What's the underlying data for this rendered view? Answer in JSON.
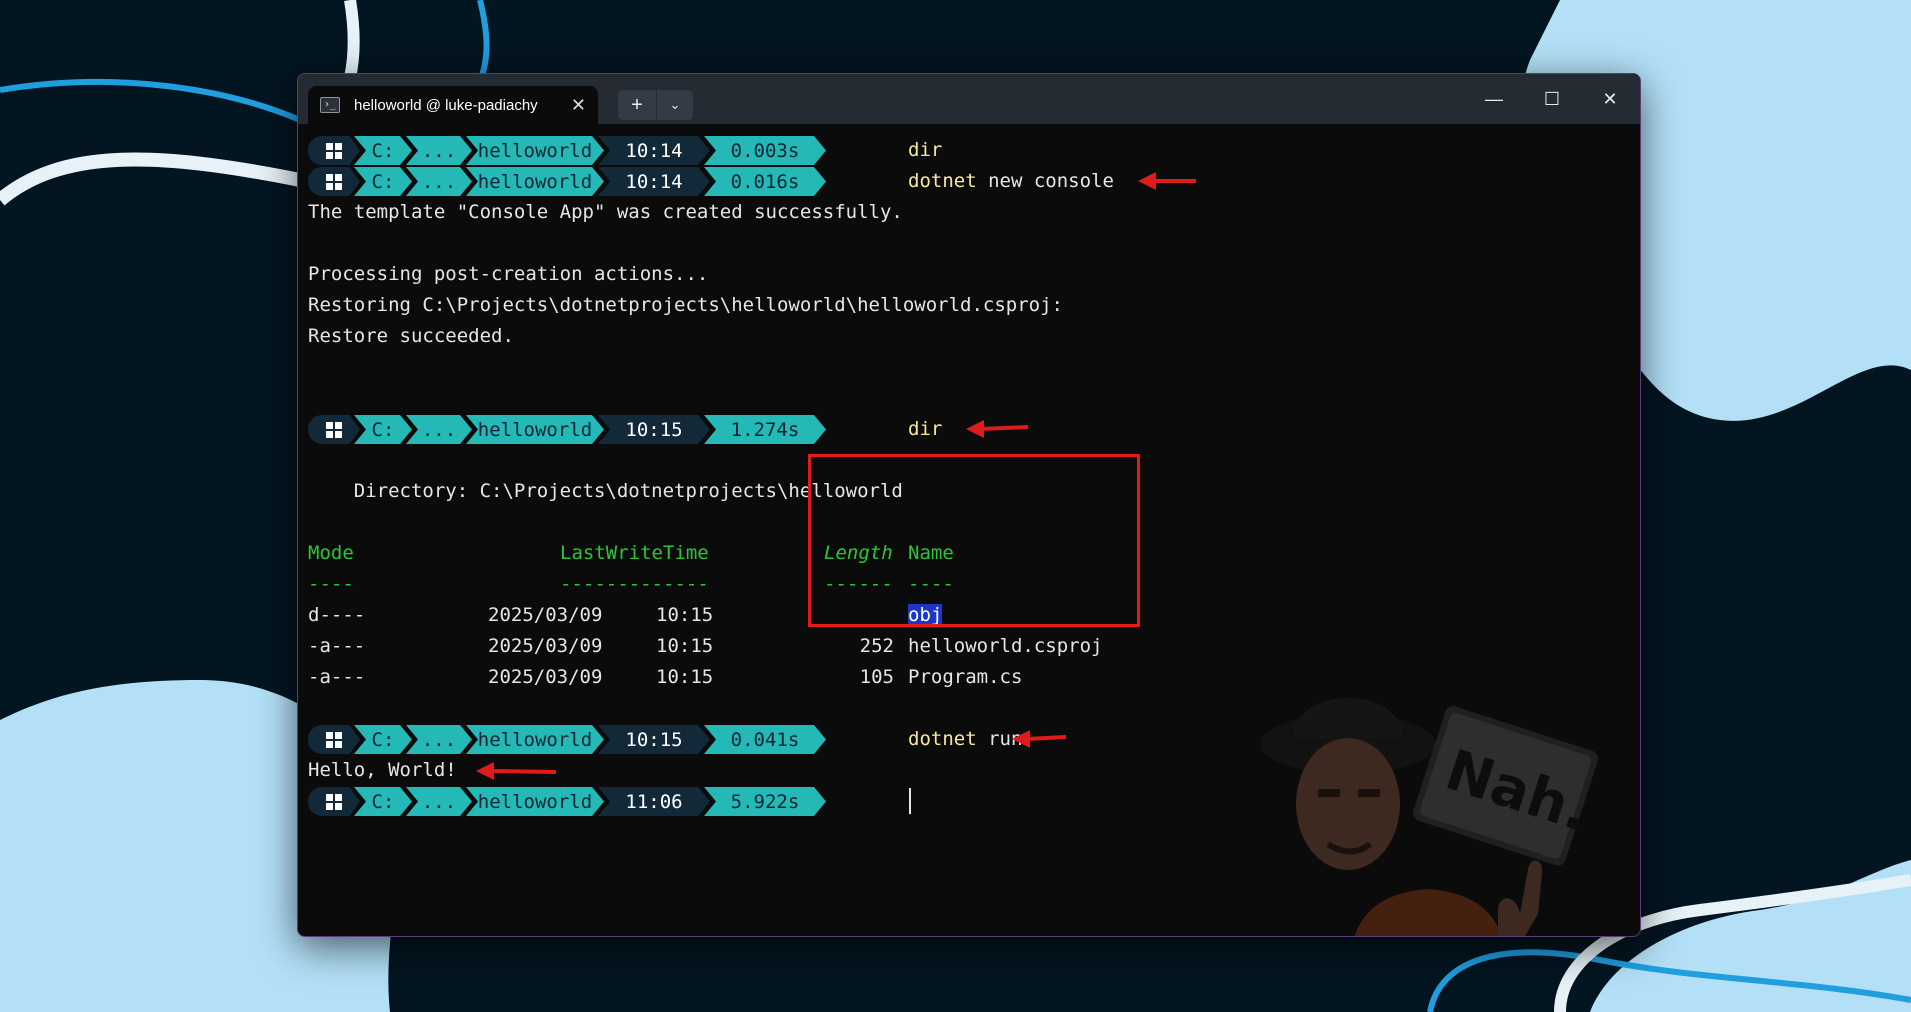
{
  "window": {
    "tab_title": "helloworld @ luke-padiachy",
    "tab_close": "✕",
    "new_tab": "+",
    "tab_dropdown": "⌄",
    "minimize": "—",
    "maximize": "☐",
    "close": "✕"
  },
  "prompts": [
    {
      "drive": "C:",
      "ellipsis": "...",
      "folder": "helloworld",
      "time": "10:14",
      "duration": "0.003s",
      "cmd_keyword": "dir",
      "cmd_args": ""
    },
    {
      "drive": "C:",
      "ellipsis": "...",
      "folder": "helloworld",
      "time": "10:14",
      "duration": "0.016s",
      "cmd_keyword": "dotnet",
      "cmd_args": " new console"
    },
    {
      "drive": "C:",
      "ellipsis": "...",
      "folder": "helloworld",
      "time": "10:15",
      "duration": "1.274s",
      "cmd_keyword": "dir",
      "cmd_args": ""
    },
    {
      "drive": "C:",
      "ellipsis": "...",
      "folder": "helloworld",
      "time": "10:15",
      "duration": "0.041s",
      "cmd_keyword": "dotnet",
      "cmd_args": " run"
    },
    {
      "drive": "C:",
      "ellipsis": "...",
      "folder": "helloworld",
      "time": "11:06",
      "duration": "5.922s",
      "cmd_keyword": "",
      "cmd_args": ""
    }
  ],
  "output": {
    "template_created": "The template \"Console App\" was created successfully.",
    "processing": "Processing post-creation actions...",
    "restoring": "Restoring C:\\Projects\\dotnetprojects\\helloworld\\helloworld.csproj:",
    "restore_ok": "Restore succeeded.",
    "directory": "    Directory: C:\\Projects\\dotnetprojects\\helloworld",
    "hello": "Hello, World!"
  },
  "listing": {
    "headers": {
      "mode": "Mode",
      "lastwrite": "LastWriteTime",
      "length": "Length",
      "name": "Name"
    },
    "underlines": {
      "mode": "----",
      "lastwrite": "-------------",
      "length": "------",
      "name": "----"
    },
    "rows": [
      {
        "mode": "d----",
        "date": "2025/03/09",
        "time": "10:15",
        "length": "",
        "name": "obj"
      },
      {
        "mode": "-a---",
        "date": "2025/03/09",
        "time": "10:15",
        "length": "252",
        "name": "helloworld.csproj"
      },
      {
        "mode": "-a---",
        "date": "2025/03/09",
        "time": "10:15",
        "length": "105",
        "name": "Program.cs"
      }
    ]
  },
  "colors": {
    "background": "#031521",
    "terminal_bg": "#0b0b0c",
    "prompt_teal": "#24b9b6",
    "prompt_dark": "#12293a",
    "header_green": "#2bc637",
    "command_yellow": "#f9e79f",
    "selection_blue": "#1d36c7",
    "annotation_red": "#e01b1b",
    "blob_light_blue": "#b3e0f7"
  },
  "sticker_text": "Nah."
}
